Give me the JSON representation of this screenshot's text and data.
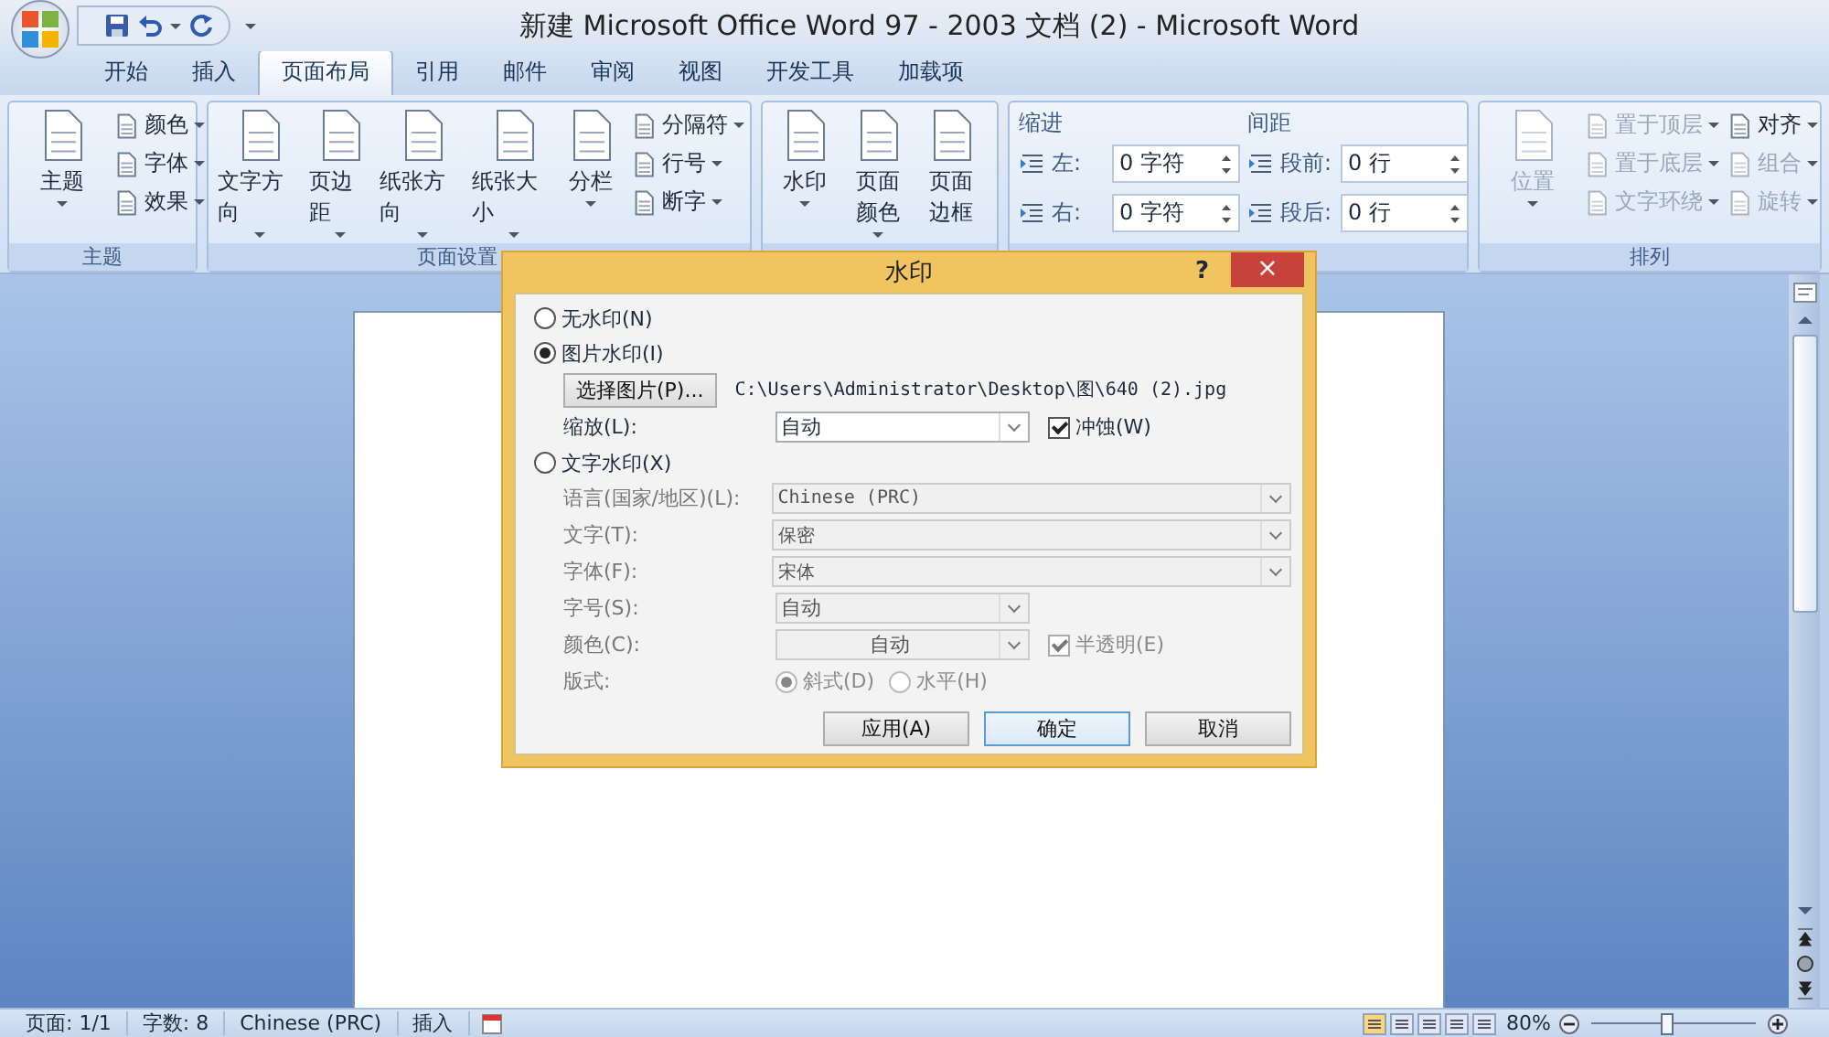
{
  "window": {
    "title": "新建 Microsoft Office Word 97 - 2003 文档 (2) - Microsoft Word"
  },
  "tabs": [
    {
      "label": "开始",
      "selected": false
    },
    {
      "label": "插入",
      "selected": false
    },
    {
      "label": "页面布局",
      "selected": true
    },
    {
      "label": "引用",
      "selected": false
    },
    {
      "label": "邮件",
      "selected": false
    },
    {
      "label": "审阅",
      "selected": false
    },
    {
      "label": "视图",
      "selected": false
    },
    {
      "label": "开发工具",
      "selected": false
    },
    {
      "label": "加载项",
      "selected": false
    }
  ],
  "ribbon": {
    "groups": [
      {
        "label": "主题",
        "columns": [
          [
            {
              "kind": "large",
              "label": "主题",
              "dropdown": true,
              "disabled": false
            }
          ],
          [
            {
              "kind": "small",
              "label": "颜色",
              "dropdown": true,
              "disabled": false
            },
            {
              "kind": "small",
              "label": "字体",
              "dropdown": true,
              "disabled": false
            },
            {
              "kind": "small",
              "label": "效果",
              "dropdown": true,
              "disabled": false
            }
          ]
        ]
      },
      {
        "label": "页面设置",
        "columns": [
          [
            {
              "kind": "large",
              "label": "文字方向",
              "dropdown": true,
              "disabled": false
            }
          ],
          [
            {
              "kind": "large",
              "label": "页边距",
              "dropdown": true,
              "disabled": false
            }
          ],
          [
            {
              "kind": "large",
              "label": "纸张方向",
              "dropdown": true,
              "disabled": false
            }
          ],
          [
            {
              "kind": "large",
              "label": "纸张大小",
              "dropdown": true,
              "disabled": false
            }
          ],
          [
            {
              "kind": "large",
              "label": "分栏",
              "dropdown": true,
              "disabled": false
            }
          ],
          [
            {
              "kind": "small",
              "label": "分隔符",
              "dropdown": true,
              "disabled": false
            },
            {
              "kind": "small",
              "label": "行号",
              "dropdown": true,
              "disabled": false
            },
            {
              "kind": "small",
              "label": "断字",
              "dropdown": true,
              "disabled": false
            }
          ]
        ]
      },
      {
        "columns": [
          [
            {
              "kind": "large",
              "label": "水印",
              "dropdown": true,
              "disabled": false
            }
          ],
          [
            {
              "kind": "large",
              "label": "页面颜色",
              "dropdown": true,
              "disabled": false
            }
          ],
          [
            {
              "kind": "large",
              "label": "页面边框",
              "dropdown": false,
              "disabled": false
            }
          ]
        ]
      },
      {
        "columns": [
          [
            {
              "kind": "heading",
              "label": "缩进"
            },
            {
              "kind": "spin",
              "label": "左:",
              "value": "0 字符"
            },
            {
              "kind": "spin",
              "label": "右:",
              "value": "0 字符"
            }
          ],
          [
            {
              "kind": "heading",
              "label": "间距"
            },
            {
              "kind": "spin",
              "label": "段前:",
              "value": "0 行"
            },
            {
              "kind": "spin",
              "label": "段后:",
              "value": "0 行"
            }
          ]
        ]
      },
      {
        "label": "排列",
        "columns": [
          [
            {
              "kind": "large",
              "label": "位置",
              "dropdown": true,
              "disabled": true
            }
          ],
          [
            {
              "kind": "small",
              "label": "置于顶层",
              "dropdown": true,
              "disabled": true
            },
            {
              "kind": "small",
              "label": "置于底层",
              "dropdown": true,
              "disabled": true
            },
            {
              "kind": "small",
              "label": "文字环绕",
              "dropdown": true,
              "disabled": true
            }
          ],
          [
            {
              "kind": "small",
              "label": "对齐",
              "dropdown": true,
              "disabled": false
            },
            {
              "kind": "small",
              "label": "组合",
              "dropdown": true,
              "disabled": true
            },
            {
              "kind": "small",
              "label": "旋转",
              "dropdown": true,
              "disabled": true
            }
          ]
        ]
      }
    ]
  },
  "dialog": {
    "title": "水印",
    "help": "?",
    "close": "×",
    "no_watermark": {
      "label": "无水印(N)",
      "selected": false
    },
    "picture_watermark": {
      "label": "图片水印(I)",
      "selected": true
    },
    "select_picture_button": "选择图片(P)...",
    "picture_path": "C:\\Users\\Administrator\\Desktop\\图\\640 (2).jpg",
    "scale": {
      "label": "缩放(L):",
      "value": "自动"
    },
    "washout": {
      "label": "冲蚀(W)",
      "checked": true,
      "disabled": false
    },
    "text_watermark": {
      "label": "文字水印(X)",
      "selected": false
    },
    "text_fields": [
      {
        "kind": "wide",
        "label": "语言(国家/地区)(L):",
        "value": "Chinese (PRC)"
      },
      {
        "kind": "wide",
        "label": "文字(T):",
        "value": "保密"
      },
      {
        "kind": "wide",
        "label": "字体(F):",
        "value": "宋体"
      },
      {
        "kind": "narrow",
        "label": "字号(S):",
        "value": "自动"
      },
      {
        "kind": "color",
        "label": "颜色(C):",
        "value": "自动"
      }
    ],
    "semitransparent": {
      "label": "半透明(E)",
      "checked": true,
      "disabled": true
    },
    "layout": {
      "label": "版式:",
      "options": [
        {
          "label": "斜式(D)",
          "selected": true
        },
        {
          "label": "水平(H)",
          "selected": false
        }
      ]
    },
    "buttons": [
      {
        "label": "应用(A)",
        "default": false
      },
      {
        "label": "确定",
        "default": true
      },
      {
        "label": "取消",
        "default": false
      }
    ]
  },
  "status_bar": {
    "items": [
      "页面: 1/1",
      "字数: 8",
      "Chinese (PRC)",
      "插入"
    ],
    "zoom": "80%",
    "zoom_slider": {
      "level": 0.45
    }
  }
}
